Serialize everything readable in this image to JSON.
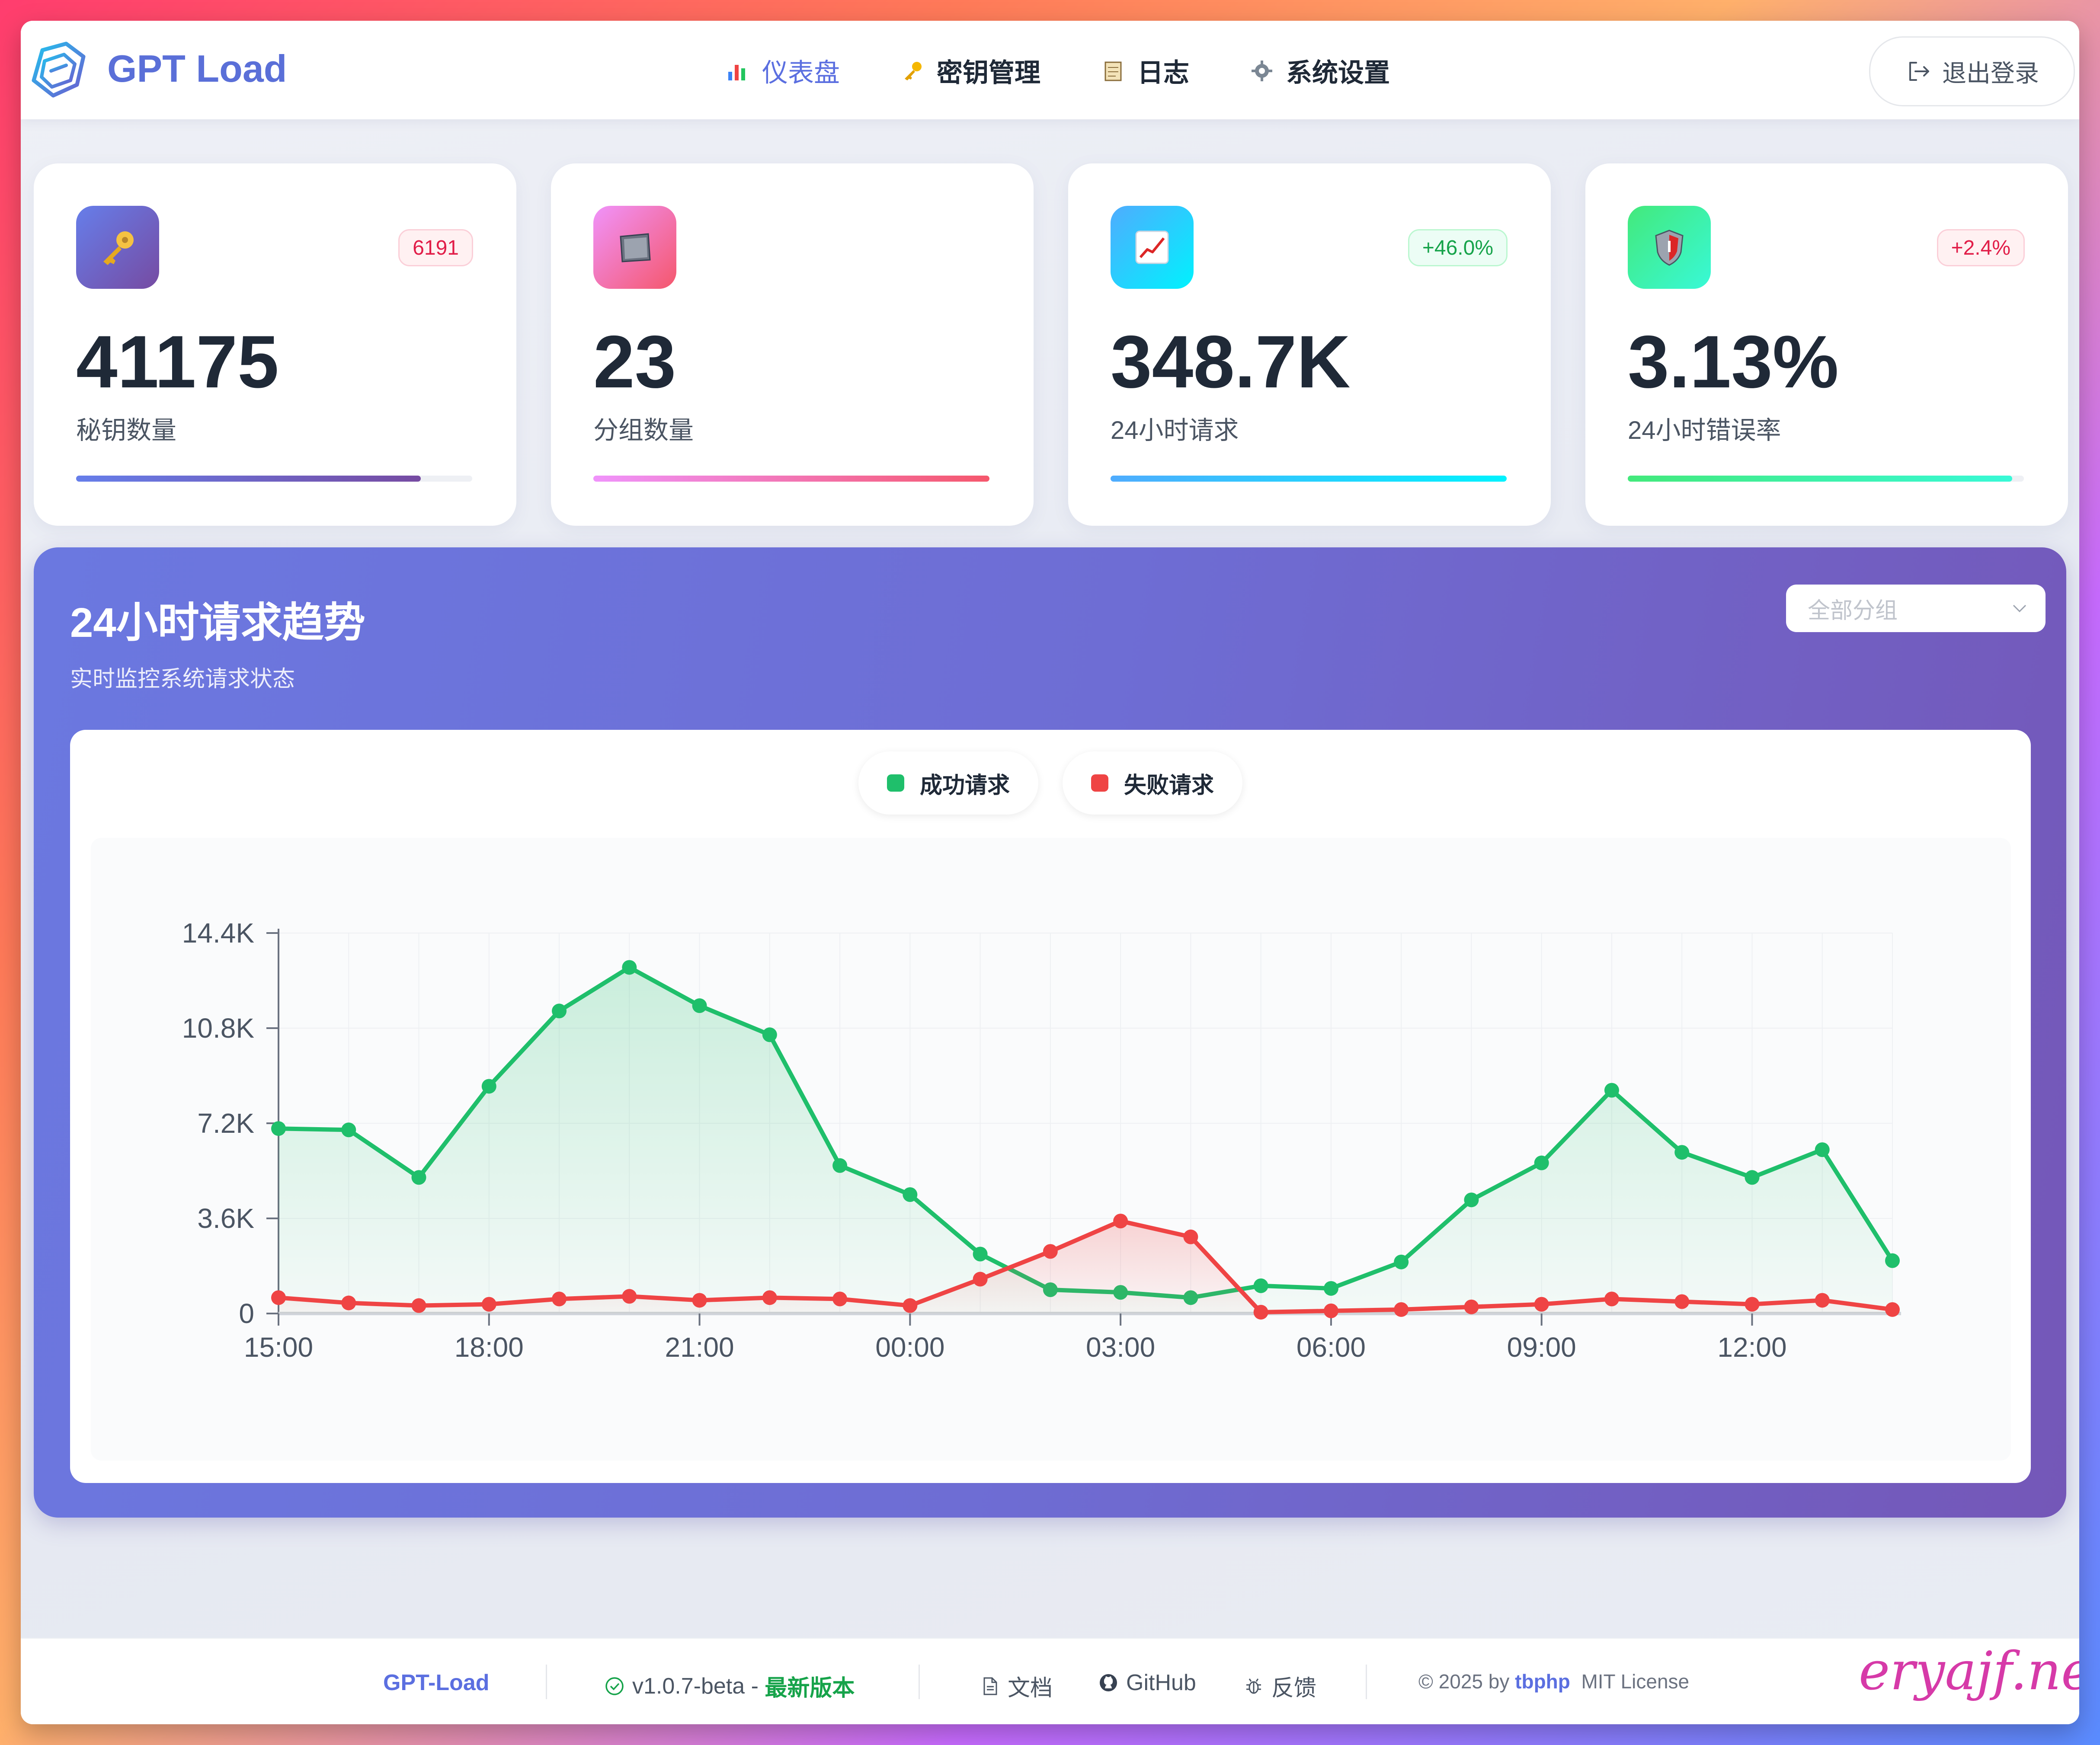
{
  "header": {
    "brand": "GPT Load",
    "nav": [
      {
        "label": "仪表盘",
        "icon": "bar-chart-icon",
        "active": true
      },
      {
        "label": "密钥管理",
        "icon": "key-icon",
        "active": false
      },
      {
        "label": "日志",
        "icon": "notepad-icon",
        "active": false
      },
      {
        "label": "系统设置",
        "icon": "gear-icon",
        "active": false
      }
    ],
    "logout_label": "退出登录"
  },
  "stats": [
    {
      "value": "41175",
      "label": "秘钥数量",
      "badge": "6191",
      "badge_type": "red",
      "progress": 0.87,
      "icon": "key-icon",
      "color_from": "#667eea",
      "color_to": "#764ba2"
    },
    {
      "value": "23",
      "label": "分组数量",
      "badge": "",
      "badge_type": "",
      "progress": 1.0,
      "icon": "folder-icon",
      "color_from": "#f093fb",
      "color_to": "#f5576c"
    },
    {
      "value": "348.7K",
      "label": "24小时请求",
      "badge": "+46.0%",
      "badge_type": "green",
      "progress": 1.0,
      "icon": "trend-chart-icon",
      "color_from": "#4facfe",
      "color_to": "#00f2fe"
    },
    {
      "value": "3.13%",
      "label": "24小时错误率",
      "badge": "+2.4%",
      "badge_type": "red",
      "progress": 0.97,
      "icon": "shield-icon",
      "color_from": "#43e97b",
      "color_to": "#38f9d7"
    }
  ],
  "panel": {
    "title": "24小时请求趋势",
    "subtitle": "实时监控系统请求状态",
    "select_placeholder": "全部分组"
  },
  "chart_data": {
    "type": "area",
    "x": [
      "15:00",
      "16:00",
      "17:00",
      "18:00",
      "19:00",
      "20:00",
      "21:00",
      "22:00",
      "23:00",
      "00:00",
      "01:00",
      "02:00",
      "03:00",
      "04:00",
      "05:00",
      "06:00",
      "07:00",
      "08:00",
      "09:00",
      "10:00",
      "11:00",
      "12:00",
      "13:00",
      "14:00"
    ],
    "xticks": [
      "15:00",
      "18:00",
      "21:00",
      "00:00",
      "03:00",
      "06:00",
      "09:00",
      "12:00"
    ],
    "yticks": [
      "0",
      "3.6K",
      "7.2K",
      "10.8K",
      "14.4K"
    ],
    "ylim": [
      0,
      14400
    ],
    "series": [
      {
        "name": "成功请求",
        "color": "#1fbf6b",
        "values": [
          7000,
          6950,
          5150,
          8600,
          11450,
          13100,
          11650,
          10550,
          5600,
          4500,
          2250,
          900,
          800,
          600,
          1050,
          950,
          1950,
          4300,
          5700,
          8450,
          6100,
          5150,
          6200,
          2000
        ]
      },
      {
        "name": "失败请求",
        "color": "#ef4444",
        "values": [
          600,
          400,
          300,
          350,
          550,
          650,
          500,
          600,
          550,
          300,
          1300,
          2350,
          3500,
          2900,
          50,
          100,
          150,
          250,
          350,
          550,
          450,
          350,
          500,
          150
        ]
      }
    ]
  },
  "footer": {
    "brand": "GPT-Load",
    "version": "v1.0.7-beta",
    "version_sep": "-",
    "version_status": "最新版本",
    "docs": "文档",
    "github": "GitHub",
    "feedback": "反馈",
    "copyright_prefix": "© 2025 by",
    "author": "tbphp",
    "license": "MIT License"
  },
  "watermark": "eryajf.net"
}
